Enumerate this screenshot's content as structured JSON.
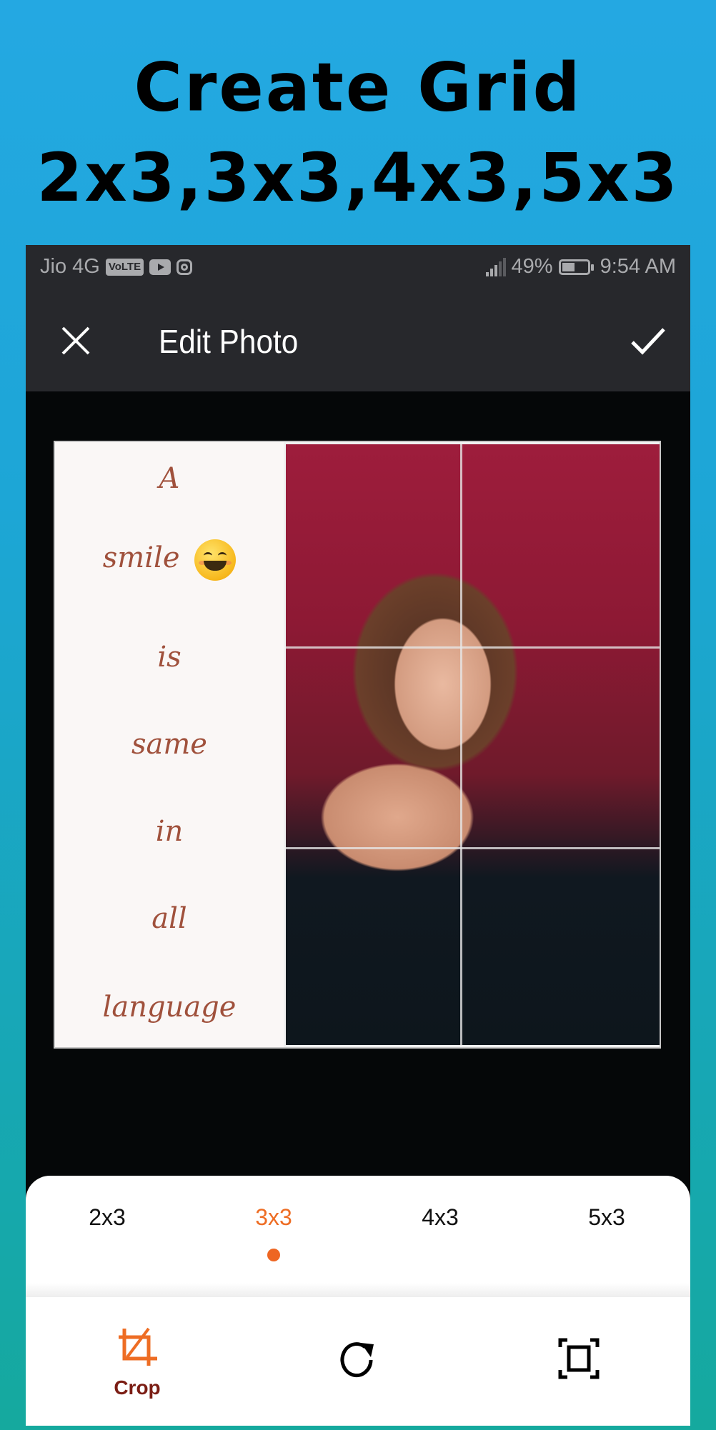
{
  "promo": {
    "title_line1": "Create  Grid",
    "title_line2": "2x3,3x3,4x3,5x3"
  },
  "status_bar": {
    "carrier": "Jio 4G",
    "volte_badge": "VoLTE",
    "left_icons": [
      "volte-icon",
      "youtube-icon",
      "instagram-icon"
    ],
    "battery_percent": "49%",
    "time": "9:54 AM",
    "right_icons": [
      "signal-icon",
      "battery-icon"
    ]
  },
  "toolbar": {
    "title": "Edit Photo",
    "close_icon": "close-icon",
    "confirm_icon": "check-icon"
  },
  "photo": {
    "quote_words": [
      "A",
      "smile",
      "is",
      "same",
      "in",
      "all",
      "language"
    ],
    "emoji": "smiling-face-emoji",
    "grid": {
      "columns": 2,
      "rows": 3,
      "selected_layout": "3x3"
    }
  },
  "colors": {
    "accent": "#ee6d24",
    "crop_label": "#7b1d14",
    "toolbar_bg": "#27282c",
    "quote_text": "#a0513c"
  },
  "ratio_tabs": [
    {
      "label": "2x3",
      "active": false
    },
    {
      "label": "3x3",
      "active": true
    },
    {
      "label": "4x3",
      "active": false
    },
    {
      "label": "5x3",
      "active": false
    }
  ],
  "tools": [
    {
      "icon": "crop-icon",
      "label": "Crop",
      "active": true
    },
    {
      "icon": "rotate-icon",
      "label": "",
      "active": false
    },
    {
      "icon": "fit-screen-icon",
      "label": "",
      "active": false
    }
  ]
}
